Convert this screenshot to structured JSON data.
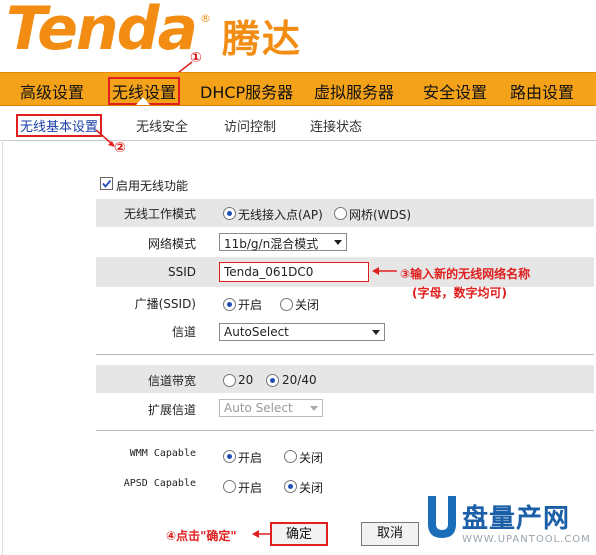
{
  "header": {
    "logo": "Tenda",
    "logo_cn": "腾达",
    "reg_mark": "®"
  },
  "main_nav": [
    "高级设置",
    "无线设置",
    "DHCP服务器",
    "虚拟服务器",
    "安全设置",
    "路由设置"
  ],
  "sub_nav": [
    "无线基本设置",
    "无线安全",
    "访问控制",
    "连接状态"
  ],
  "form": {
    "enable_label": "启用无线功能",
    "enable_checked": true,
    "mode_label": "无线工作模式",
    "mode_opt_ap": "无线接入点(AP)",
    "mode_opt_wds": "网桥(WDS)",
    "net_mode_label": "网络模式",
    "net_mode_value": "11b/g/n混合模式",
    "ssid_label": "SSID",
    "ssid_value": "Tenda_061DC0",
    "broadcast_label": "广播(SSID)",
    "on": "开启",
    "off": "关闭",
    "channel_label": "信道",
    "channel_value": "AutoSelect",
    "bandwidth_label": "信道带宽",
    "bw_20": "20",
    "bw_2040": "20/40",
    "ext_channel_label": "扩展信道",
    "ext_channel_value": "Auto Select",
    "wmm_label": "WMM Capable",
    "apsd_label": "APSD Capable"
  },
  "buttons": {
    "ok": "确定",
    "cancel": "取消"
  },
  "annotations": {
    "a1": "①",
    "a2": "②",
    "a3_line1": "③输入新的无线网络名称",
    "a3_line2": "(字母，数字均可)",
    "a4": "④点击\"确定\""
  },
  "watermark": {
    "brand": "盘量产网",
    "url": "WWW.UPANTOOL.COM"
  },
  "colors": {
    "brand_orange": "#f28c12",
    "nav_bg": "#f3a21a",
    "annotation_red": "#e02020",
    "link_blue": "#1b3fa6"
  }
}
